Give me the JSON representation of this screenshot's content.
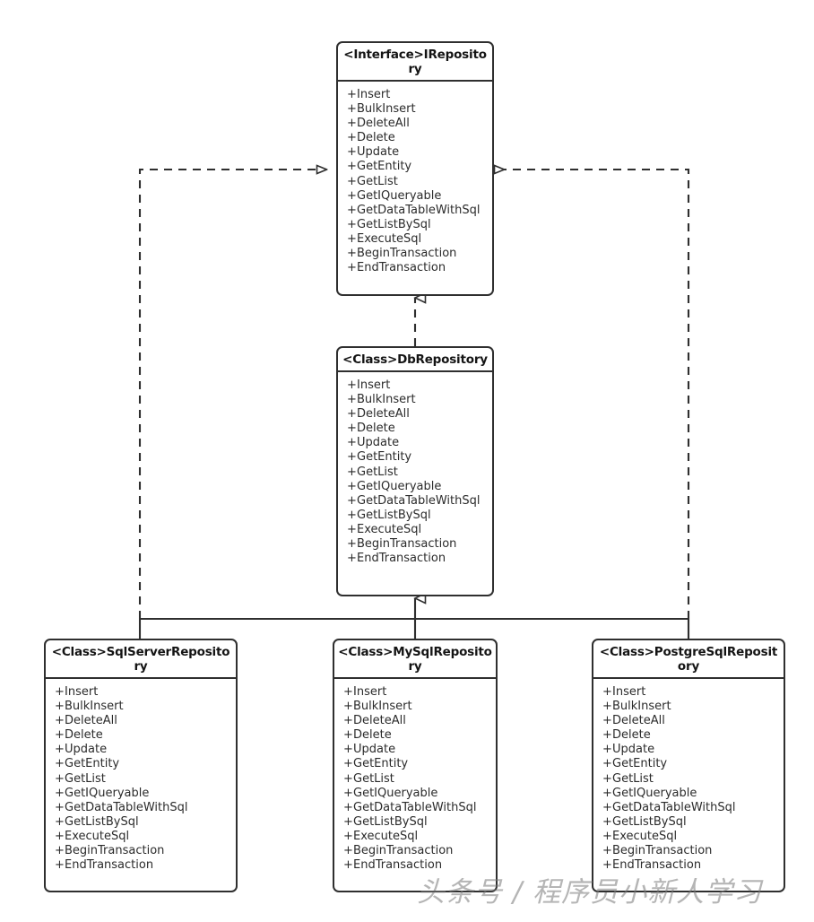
{
  "diagram": {
    "title": "Repository UML Class Diagram",
    "background_color": "#ffffff",
    "line_color": "#2f2f2f",
    "text_color": "#232323"
  },
  "methods": {
    "standard": [
      "Insert",
      "BulkInsert",
      "DeleteAll",
      "Delete",
      "Update",
      "GetEntity",
      "GetList",
      "GetIQueryable",
      "GetDataTableWithSql",
      "GetListBySql",
      "ExecuteSql",
      "BeginTransaction",
      "EndTransaction"
    ]
  },
  "nodes": {
    "irepository": {
      "stereotype": "<Interface>",
      "name": "IRepository",
      "header": "<Interface>IRepository",
      "visibility": "+",
      "members": [
        "Insert",
        "BulkInsert",
        "DeleteAll",
        "Delete",
        "Update",
        "GetEntity",
        "GetList",
        "GetIQueryable",
        "GetDataTableWithSql",
        "GetListBySql",
        "ExecuteSql",
        "BeginTransaction",
        "EndTransaction"
      ]
    },
    "dbrepository": {
      "stereotype": "<Class>",
      "name": "DbRepository",
      "header": "<Class>DbRepository",
      "visibility": "+",
      "members": [
        "Insert",
        "BulkInsert",
        "DeleteAll",
        "Delete",
        "Update",
        "GetEntity",
        "GetList",
        "GetIQueryable",
        "GetDataTableWithSql",
        "GetListBySql",
        "ExecuteSql",
        "BeginTransaction",
        "EndTransaction"
      ]
    },
    "sqlserverrepository": {
      "stereotype": "<Class>",
      "name": "SqlServerRepository",
      "header": "<Class>SqlServerRepository",
      "visibility": "+",
      "members": [
        "Insert",
        "BulkInsert",
        "DeleteAll",
        "Delete",
        "Update",
        "GetEntity",
        "GetList",
        "GetIQueryable",
        "GetDataTableWithSql",
        "GetListBySql",
        "ExecuteSql",
        "BeginTransaction",
        "EndTransaction"
      ]
    },
    "mysqlrepository": {
      "stereotype": "<Class>",
      "name": "MySqlRepository",
      "header": "<Class>MySqlRepository",
      "visibility": "+",
      "members": [
        "Insert",
        "BulkInsert",
        "DeleteAll",
        "Delete",
        "Update",
        "GetEntity",
        "GetList",
        "GetIQueryable",
        "GetDataTableWithSql",
        "GetListBySql",
        "ExecuteSql",
        "BeginTransaction",
        "EndTransaction"
      ]
    },
    "postgresqlrepository": {
      "stereotype": "<Class>",
      "name": "PostgreSqlRepository",
      "header": "<Class>PostgreSqlRepository",
      "visibility": "+",
      "members": [
        "Insert",
        "BulkInsert",
        "DeleteAll",
        "Delete",
        "Update",
        "GetEntity",
        "GetList",
        "GetIQueryable",
        "GetDataTableWithSql",
        "GetListBySql",
        "ExecuteSql",
        "BeginTransaction",
        "EndTransaction"
      ]
    }
  },
  "relationships": [
    {
      "from": "SqlServerRepository",
      "to": "IRepository",
      "type": "realization",
      "style": "dashed",
      "arrowhead": "hollow-triangle"
    },
    {
      "from": "PostgreSqlRepository",
      "to": "IRepository",
      "type": "realization",
      "style": "dashed",
      "arrowhead": "hollow-triangle"
    },
    {
      "from": "DbRepository",
      "to": "IRepository",
      "type": "realization",
      "style": "dashed",
      "arrowhead": "hollow-triangle"
    },
    {
      "from": "SqlServerRepository",
      "to": "DbRepository",
      "type": "generalization",
      "style": "solid",
      "arrowhead": "hollow-triangle"
    },
    {
      "from": "MySqlRepository",
      "to": "DbRepository",
      "type": "generalization",
      "style": "solid",
      "arrowhead": "hollow-triangle"
    },
    {
      "from": "PostgreSqlRepository",
      "to": "DbRepository",
      "type": "generalization",
      "style": "solid",
      "arrowhead": "hollow-triangle"
    }
  ],
  "watermark": {
    "text": "头条号 / 程序员小新人学习"
  }
}
